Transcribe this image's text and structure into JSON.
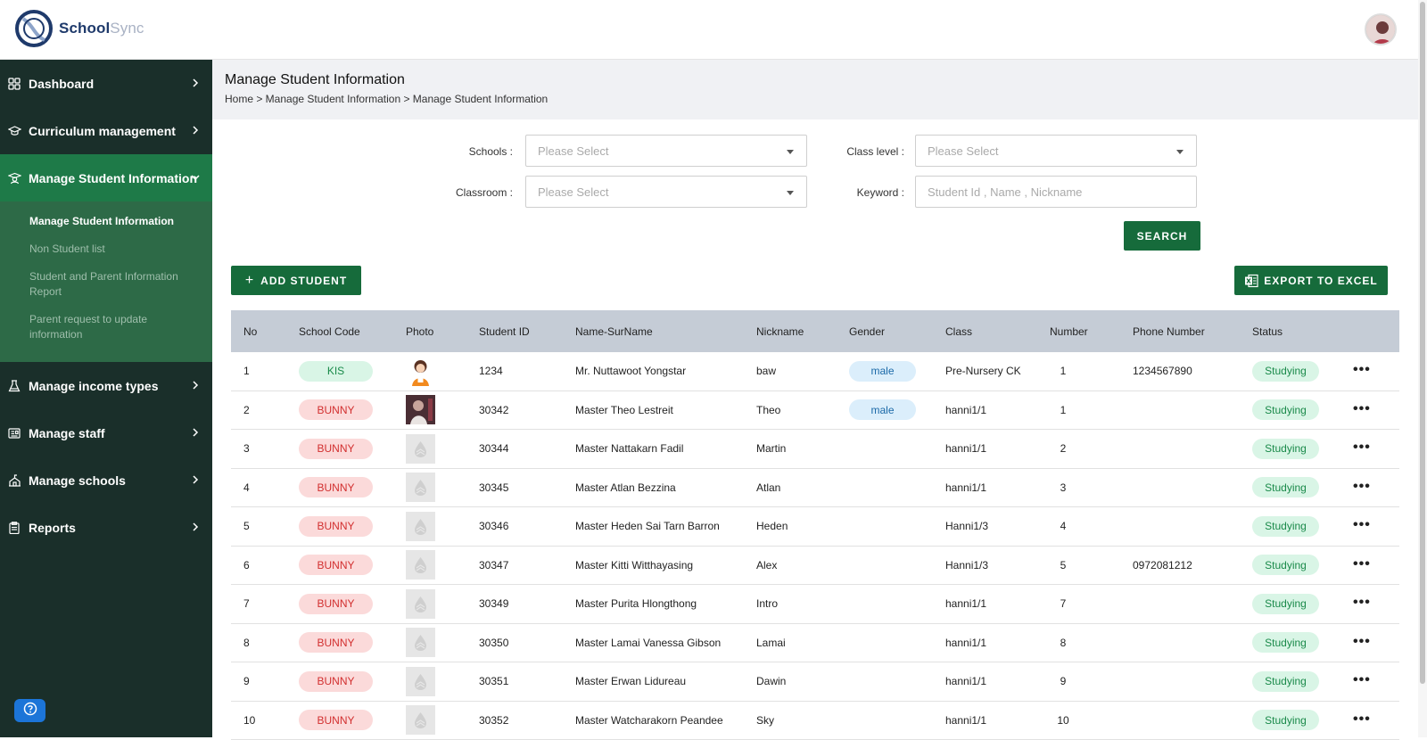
{
  "brand": {
    "name_part1": "School",
    "name_part2": "Sync"
  },
  "sidebar": {
    "items": [
      {
        "label": "Dashboard",
        "icon": "grid-icon"
      },
      {
        "label": "Curriculum management",
        "icon": "graduation-cap-icon"
      },
      {
        "label": "Manage Student Information",
        "icon": "student-icon",
        "active": true
      },
      {
        "label": "Manage income types",
        "icon": "flask-icon"
      },
      {
        "label": "Manage staff",
        "icon": "id-card-icon"
      },
      {
        "label": "Manage schools",
        "icon": "school-icon"
      },
      {
        "label": "Reports",
        "icon": "clipboard-icon"
      }
    ],
    "submenu": [
      {
        "label": "Manage Student Information",
        "current": true
      },
      {
        "label": "Non Student list"
      },
      {
        "label": "Student and Parent Information Report"
      },
      {
        "label": "Parent request to update information"
      }
    ]
  },
  "page": {
    "title": "Manage Student Information",
    "breadcrumb": "Home > Manage Student Information > Manage Student Information"
  },
  "filters": {
    "schools_label": "Schools :",
    "schools_placeholder": "Please Select",
    "class_level_label": "Class level :",
    "class_level_placeholder": "Please Select",
    "classroom_label": "Classroom :",
    "classroom_placeholder": "Please Select",
    "keyword_label": "Keyword :",
    "keyword_placeholder": "Student Id , Name , Nickname",
    "search_label": "SEARCH"
  },
  "actions": {
    "add_student": "ADD STUDENT",
    "export_excel": "EXPORT TO EXCEL"
  },
  "table": {
    "columns": [
      "No",
      "School Code",
      "Photo",
      "Student ID",
      "Name-SurName",
      "Nickname",
      "Gender",
      "Class",
      "Number",
      "Phone Number",
      "Status"
    ],
    "rows": [
      {
        "no": "1",
        "school": "KIS",
        "photo": "cartoon",
        "id": "1234",
        "name": "Mr. Nuttawoot Yongstar",
        "nickname": "baw",
        "gender": "male",
        "class": "Pre-Nursery CK",
        "number": "1",
        "phone": "1234567890",
        "status": "Studying"
      },
      {
        "no": "2",
        "school": "BUNNY",
        "photo": "photo",
        "id": "30342",
        "name": "Master Theo Lestreit",
        "nickname": "Theo",
        "gender": "male",
        "class": "hanni1/1",
        "number": "1",
        "phone": "",
        "status": "Studying"
      },
      {
        "no": "3",
        "school": "BUNNY",
        "photo": "placeholder",
        "id": "30344",
        "name": "Master Nattakarn Fadil",
        "nickname": "Martin",
        "gender": "",
        "class": "hanni1/1",
        "number": "2",
        "phone": "",
        "status": "Studying"
      },
      {
        "no": "4",
        "school": "BUNNY",
        "photo": "placeholder",
        "id": "30345",
        "name": "Master Atlan Bezzina",
        "nickname": "Atlan",
        "gender": "",
        "class": "hanni1/1",
        "number": "3",
        "phone": "",
        "status": "Studying"
      },
      {
        "no": "5",
        "school": "BUNNY",
        "photo": "placeholder",
        "id": "30346",
        "name": "Master Heden Sai Tarn Barron",
        "nickname": "Heden",
        "gender": "",
        "class": "Hanni1/3",
        "number": "4",
        "phone": "",
        "status": "Studying"
      },
      {
        "no": "6",
        "school": "BUNNY",
        "photo": "placeholder",
        "id": "30347",
        "name": "Master Kitti Witthayasing",
        "nickname": "Alex",
        "gender": "",
        "class": "Hanni1/3",
        "number": "5",
        "phone": "0972081212",
        "status": "Studying"
      },
      {
        "no": "7",
        "school": "BUNNY",
        "photo": "placeholder",
        "id": "30349",
        "name": "Master Purita Hlongthong",
        "nickname": "Intro",
        "gender": "",
        "class": "hanni1/1",
        "number": "7",
        "phone": "",
        "status": "Studying"
      },
      {
        "no": "8",
        "school": "BUNNY",
        "photo": "placeholder",
        "id": "30350",
        "name": "Master Lamai Vanessa Gibson",
        "nickname": "Lamai",
        "gender": "",
        "class": "hanni1/1",
        "number": "8",
        "phone": "",
        "status": "Studying"
      },
      {
        "no": "9",
        "school": "BUNNY",
        "photo": "placeholder",
        "id": "30351",
        "name": "Master Erwan Lidureau",
        "nickname": "Dawin",
        "gender": "",
        "class": "hanni1/1",
        "number": "9",
        "phone": "",
        "status": "Studying"
      },
      {
        "no": "10",
        "school": "BUNNY",
        "photo": "placeholder",
        "id": "30352",
        "name": "Master Watcharakorn Peandee",
        "nickname": "Sky",
        "gender": "",
        "class": "hanni1/1",
        "number": "10",
        "phone": "",
        "status": "Studying"
      }
    ]
  }
}
